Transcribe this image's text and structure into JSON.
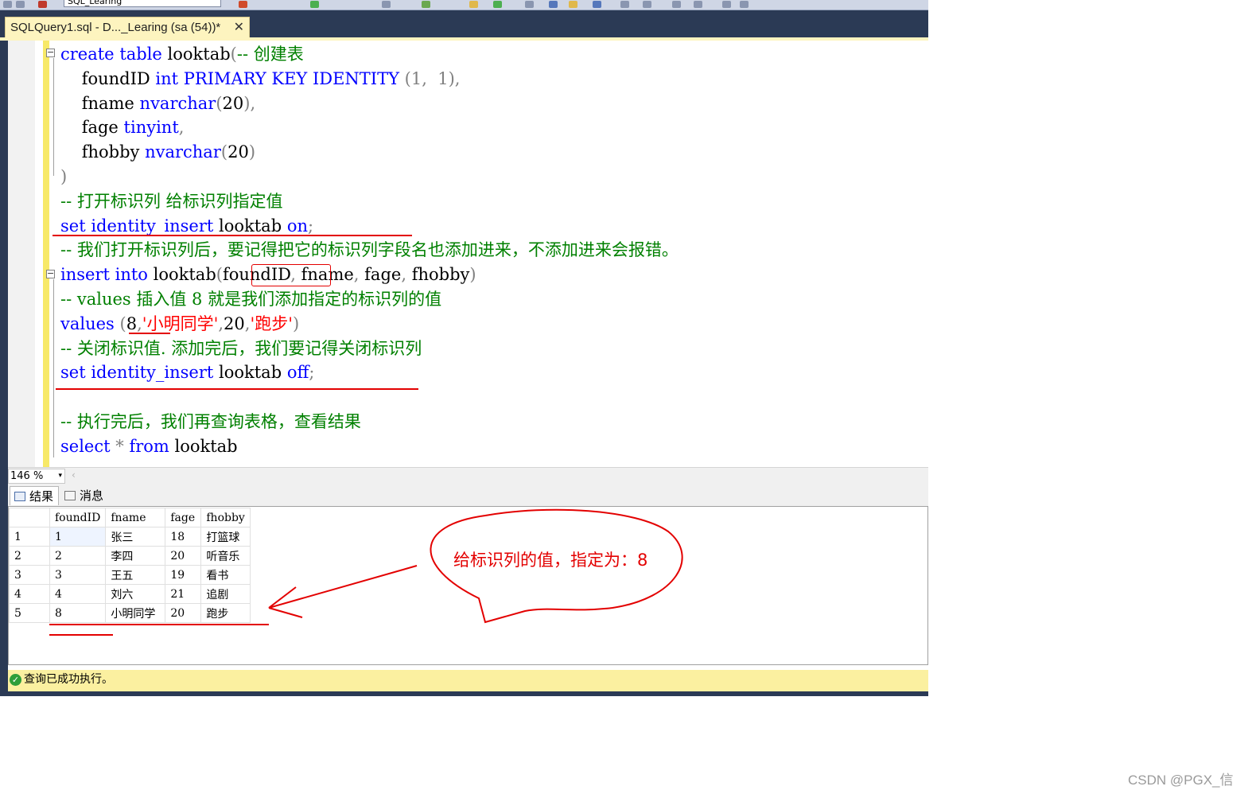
{
  "toolbar": {
    "database_value": "SQL_Learing"
  },
  "document_tab": {
    "title": "SQLQuery1.sql - D..._Learing (sa (54))*",
    "close_glyph": "✕"
  },
  "editor": {
    "lines": [
      [
        {
          "t": "create",
          "c": "kw"
        },
        {
          "t": " "
        },
        {
          "t": "table",
          "c": "kw"
        },
        {
          "t": " looktab"
        },
        {
          "t": "(",
          "c": "gr"
        },
        {
          "t": "-- 创建表",
          "c": "cm"
        }
      ],
      [
        {
          "t": "    foundID "
        },
        {
          "t": "int",
          "c": "kw"
        },
        {
          "t": " "
        },
        {
          "t": "PRIMARY KEY IDENTITY",
          "c": "kw"
        },
        {
          "t": " (1,  1),",
          "c": "gr"
        }
      ],
      [
        {
          "t": "    fname "
        },
        {
          "t": "nvarchar",
          "c": "kw"
        },
        {
          "t": "(",
          "c": "gr"
        },
        {
          "t": "20"
        },
        {
          "t": "),",
          "c": "gr"
        }
      ],
      [
        {
          "t": "    fage "
        },
        {
          "t": "tinyint",
          "c": "kw"
        },
        {
          "t": ",",
          "c": "gr"
        }
      ],
      [
        {
          "t": "    fhobby "
        },
        {
          "t": "nvarchar",
          "c": "kw"
        },
        {
          "t": "(",
          "c": "gr"
        },
        {
          "t": "20"
        },
        {
          "t": ")",
          "c": "gr"
        }
      ],
      [
        {
          "t": ")",
          "c": "gr"
        }
      ],
      [
        {
          "t": "-- 打开标识列 给标识列指定值",
          "c": "cm"
        }
      ],
      [
        {
          "t": "set",
          "c": "kw"
        },
        {
          "t": " "
        },
        {
          "t": "identity_insert",
          "c": "kw"
        },
        {
          "t": " looktab "
        },
        {
          "t": "on",
          "c": "kw"
        },
        {
          "t": ";",
          "c": "gr"
        }
      ],
      [
        {
          "t": "-- 我们打开标识列后，要记得把它的标识列字段名也添加进来，不添加进来会报错。",
          "c": "cm"
        }
      ],
      [
        {
          "t": "insert",
          "c": "kw"
        },
        {
          "t": " "
        },
        {
          "t": "into",
          "c": "kw"
        },
        {
          "t": " looktab"
        },
        {
          "t": "(",
          "c": "gr"
        },
        {
          "t": "foundID"
        },
        {
          "t": ",",
          "c": "gr"
        },
        {
          "t": " fname"
        },
        {
          "t": ",",
          "c": "gr"
        },
        {
          "t": " fage"
        },
        {
          "t": ",",
          "c": "gr"
        },
        {
          "t": " fhobby"
        },
        {
          "t": ")",
          "c": "gr"
        }
      ],
      [
        {
          "t": "-- values 插入值 8 就是我们添加指定的标识列的值",
          "c": "cm"
        }
      ],
      [
        {
          "t": "values",
          "c": "kw"
        },
        {
          "t": " "
        },
        {
          "t": "(",
          "c": "gr"
        },
        {
          "t": "8"
        },
        {
          "t": ",",
          "c": "gr"
        },
        {
          "t": "'小明同学'",
          "c": "str"
        },
        {
          "t": ",",
          "c": "gr"
        },
        {
          "t": "20"
        },
        {
          "t": ",",
          "c": "gr"
        },
        {
          "t": "'跑步'",
          "c": "str"
        },
        {
          "t": ")",
          "c": "gr"
        }
      ],
      [
        {
          "t": "-- 关闭标识值. 添加完后，我们要记得关闭标识列",
          "c": "cm"
        }
      ],
      [
        {
          "t": "set",
          "c": "kw"
        },
        {
          "t": " "
        },
        {
          "t": "identity_insert",
          "c": "kw"
        },
        {
          "t": " looktab "
        },
        {
          "t": "off",
          "c": "kw"
        },
        {
          "t": ";",
          "c": "gr"
        }
      ],
      [],
      [
        {
          "t": "-- 执行完后，我们再查询表格，查看结果",
          "c": "cm"
        }
      ],
      [
        {
          "t": "select",
          "c": "kw"
        },
        {
          "t": " "
        },
        {
          "t": "*",
          "c": "gr"
        },
        {
          "t": " "
        },
        {
          "t": "from",
          "c": "kw"
        },
        {
          "t": " looktab"
        }
      ]
    ]
  },
  "zoom": {
    "value": "146 %",
    "arrow": "▾",
    "scroll_left": "‹"
  },
  "results": {
    "tab_results": "结果",
    "tab_messages": "消息",
    "columns": [
      "foundID",
      "fname",
      "fage",
      "fhobby"
    ],
    "rows": [
      {
        "n": "1",
        "foundID": "1",
        "fname": "张三",
        "fage": "18",
        "fhobby": "打篮球"
      },
      {
        "n": "2",
        "foundID": "2",
        "fname": "李四",
        "fage": "20",
        "fhobby": "听音乐"
      },
      {
        "n": "3",
        "foundID": "3",
        "fname": "王五",
        "fage": "19",
        "fhobby": "看书"
      },
      {
        "n": "4",
        "foundID": "4",
        "fname": "刘六",
        "fage": "21",
        "fhobby": "追剧"
      },
      {
        "n": "5",
        "foundID": "8",
        "fname": "小明同学",
        "fage": "20",
        "fhobby": "跑步"
      }
    ]
  },
  "status": {
    "icon": "✓",
    "message": "查询已成功执行。"
  },
  "annotation": {
    "callout_text": "给标识列的值，指定为：8",
    "color": "#e30000"
  },
  "watermark": "CSDN @PGX_信"
}
